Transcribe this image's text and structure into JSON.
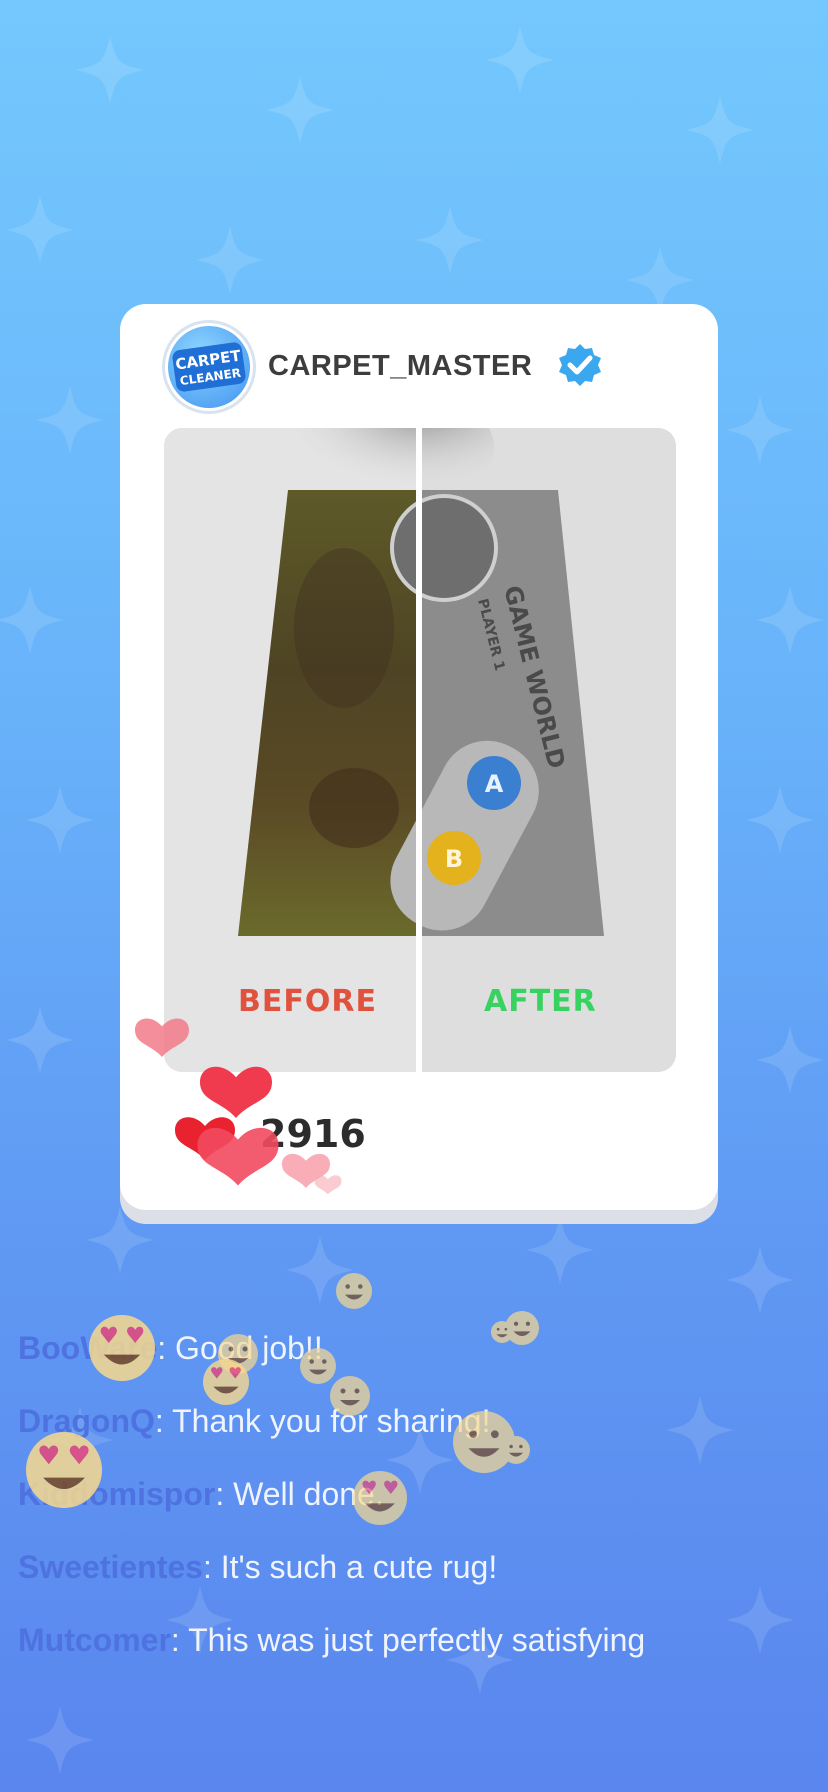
{
  "post": {
    "username": "CARPET_MASTER",
    "avatar_logo_line1": "CARPET",
    "avatar_logo_line2": "CLEANER",
    "before_label": "BEFORE",
    "after_label": "AFTER",
    "rug_text_line1": "GAME WORLD",
    "rug_text_line2": "PLAYER 1",
    "rug_button_a": "A",
    "rug_button_b": "B",
    "likes": "2916"
  },
  "comments": [
    {
      "user": "BooWare",
      "text": ": Good job!!"
    },
    {
      "user": "DragonQ",
      "text": ": Thank you for sharing!"
    },
    {
      "user": "Kiddomispor",
      "text": ": Well done."
    },
    {
      "user": "Sweetientes",
      "text": ": It's such a cute rug!"
    },
    {
      "user": "Mutcomer",
      "text": ": This was just perfectly satisfying"
    }
  ],
  "colors": {
    "background_top": "#74c8fd",
    "background_bottom": "#5a86ee",
    "username_comment": "#4e73e0",
    "before_label": "#e0513e",
    "after_label": "#38d260",
    "heart": "#f0303f",
    "verified_badge": "#3aa7ef"
  },
  "icons": [
    "verified-badge-icon",
    "heart-icon",
    "heart-eyes-emoji-icon",
    "smile-emoji-icon"
  ]
}
